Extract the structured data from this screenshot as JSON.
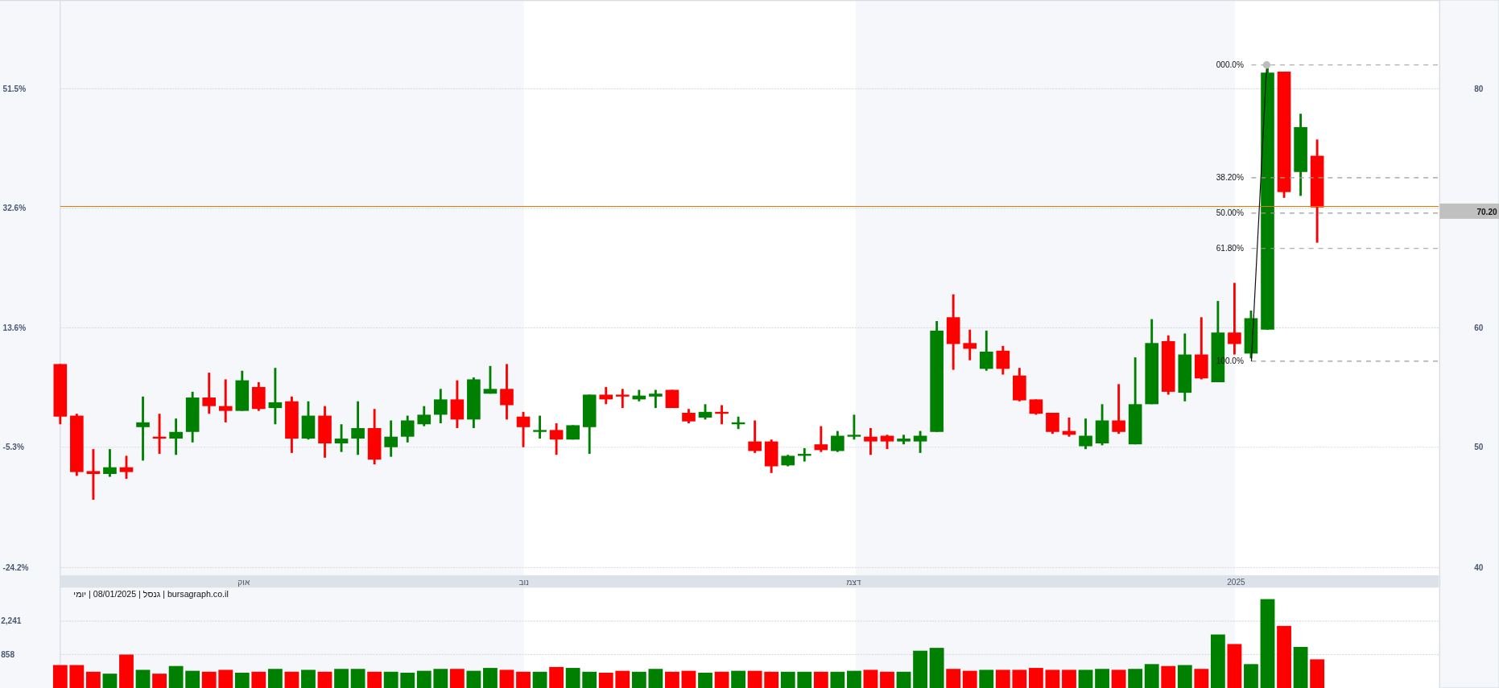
{
  "price_axis_left": {
    "ticks": [
      "51.5%",
      "32.6%",
      "13.6%",
      "-5.3%",
      "-24.2%"
    ]
  },
  "price_axis_right": {
    "ticks": [
      "80",
      "60",
      "50",
      "40"
    ],
    "current_price": "70.20"
  },
  "fibonacci": {
    "levels": [
      "000.0%",
      "38.20%",
      "50.00%",
      "61.80%",
      "100.0%"
    ]
  },
  "time_axis": {
    "labels": [
      "2025",
      "דצמ",
      "נוב",
      "אוק"
    ]
  },
  "info_line": "bursagraph.co.il | גנסל | 08/01/2025 | יומי",
  "volume_axis": {
    "ticks": [
      "2,241",
      "858"
    ]
  }
}
